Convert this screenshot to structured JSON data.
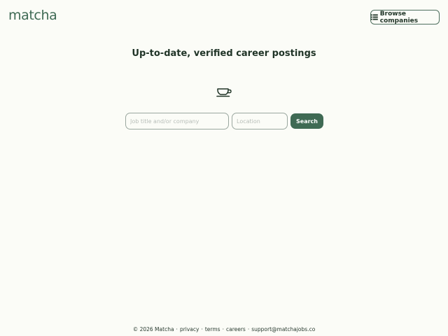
{
  "header": {
    "logo_text": "matcha",
    "browse_label": "Browse companies",
    "browse_icon": "list-icon"
  },
  "hero": {
    "headline": "Up-to-date, verified career postings",
    "icon": "coffee-cup-icon"
  },
  "search": {
    "job_placeholder": "Job title and/or company",
    "job_value": "",
    "location_placeholder": "Location",
    "location_value": "",
    "button_label": "Search"
  },
  "footer": {
    "copyright": "© 2026 Matcha",
    "separator": "·",
    "links": [
      "privacy",
      "terms",
      "careers",
      "support@matchajobs.co"
    ]
  },
  "colors": {
    "background": "#fbfcf7",
    "accent": "#3f6a54",
    "text": "#1f3326"
  }
}
